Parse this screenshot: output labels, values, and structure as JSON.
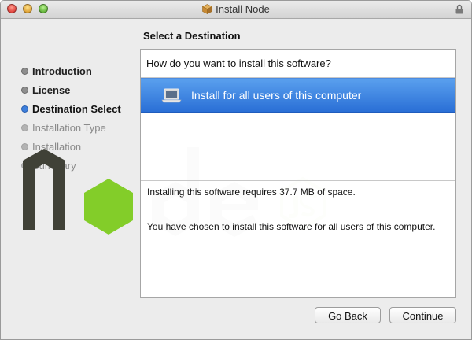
{
  "window": {
    "title": "Install Node"
  },
  "page": {
    "heading": "Select a Destination"
  },
  "steps": [
    {
      "label": "Introduction",
      "state": "done"
    },
    {
      "label": "License",
      "state": "done"
    },
    {
      "label": "Destination Select",
      "state": "current"
    },
    {
      "label": "Installation Type",
      "state": "future"
    },
    {
      "label": "Installation",
      "state": "future"
    },
    {
      "label": "Summary",
      "state": "future"
    }
  ],
  "panel": {
    "question": "How do you want to install this software?",
    "option_label": "Install for all users of this computer",
    "space_info": "Installing this software requires 37.7 MB of space.",
    "choice_info": "You have chosen to install this software for all users of this computer."
  },
  "buttons": {
    "back": "Go Back",
    "continue": "Continue"
  },
  "colors": {
    "selection": "#2a6fd6",
    "node_dark": "#404137",
    "node_green": "#83cd29",
    "node_gray": "#8c8c8c"
  }
}
